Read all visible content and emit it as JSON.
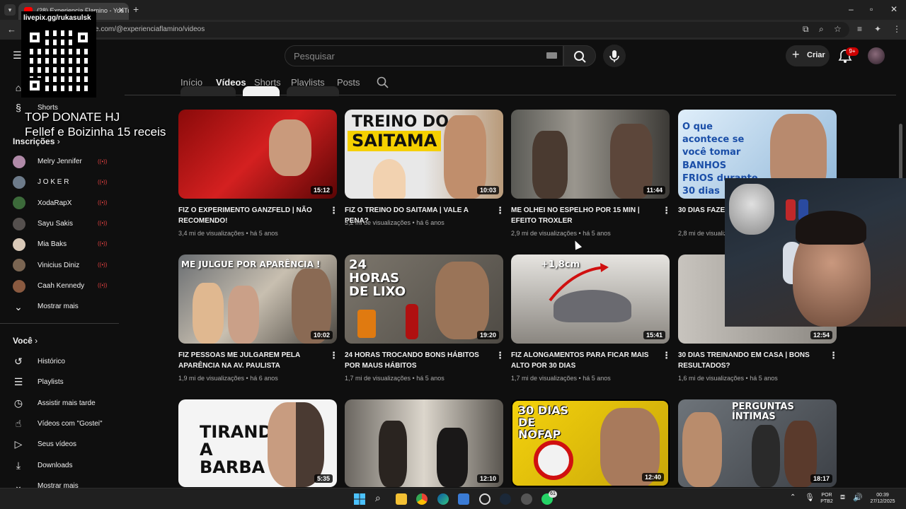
{
  "browser": {
    "tab_title": "(28) Experiencia Flamino - YouTube",
    "url_visible": "e.com/@experienciaflamino/videos"
  },
  "header": {
    "search_placeholder": "Pesquisar",
    "create_label": "Criar",
    "notif_count": "9+"
  },
  "channel_tabs": [
    "Início",
    "Vídeos",
    "Shorts",
    "Playlists",
    "Posts"
  ],
  "active_tab": "Vídeos",
  "sidebar": {
    "shorts_label": "Shorts",
    "subs_heading": "Inscrições",
    "subscriptions": [
      "Melry Jennifer",
      "J O K E R",
      "XodaRapX",
      "Sayu Sakis",
      "Mia Baks",
      "Vinicius Diniz",
      "Caah Kennedy"
    ],
    "show_more": "Mostrar mais",
    "you_heading": "Você",
    "you_items": [
      "Histórico",
      "Playlists",
      "Assistir mais tarde",
      "Vídeos com \"Gostei\"",
      "Seus vídeos",
      "Downloads",
      "Mostrar mais"
    ]
  },
  "overlays": {
    "qr_title": "livepix.gg/rukasulsk",
    "donate_line1": "TOP DONATE HJ",
    "donate_line2": "Fellef e Boizinha 15 receis"
  },
  "videos": [
    {
      "title": "FIZ O EXPERIMENTO GANZFELD | NÃO RECOMENDO!",
      "views": "3,4 mi de visualizações",
      "age": "há 5 anos",
      "duration": "15:12",
      "thumb_text": ""
    },
    {
      "title": "FIZ O TREINO DO SAITAMA | VALE A PENA?",
      "views": "3,2 mi de visualizações",
      "age": "há 6 anos",
      "duration": "10:03",
      "thumb_text": "TREINO DO SAITAMA"
    },
    {
      "title": "ME OLHEI NO ESPELHO POR 15 MIN | EFEITO TROXLER",
      "views": "2,9 mi de visualizações",
      "age": "há 5 anos",
      "duration": "11:44",
      "thumb_text": ""
    },
    {
      "title": "30 DIAS FAZEN... DOENÇA DE P...",
      "views": "2,8 mi de visualiz...",
      "age": "",
      "duration": "",
      "thumb_text": "O que acontece se você tomar BANHOS FRIOS durante 30 dias"
    },
    {
      "title": "FIZ PESSOAS ME JULGAREM PELA APARÊNCIA NA AV. PAULISTA",
      "views": "1,9 mi de visualizações",
      "age": "há 6 anos",
      "duration": "10:02",
      "thumb_text": "ME JULGUE POR APARÊNCIA !"
    },
    {
      "title": "24 HORAS TROCANDO BONS HÁBITOS POR MAUS HÁBITOS",
      "views": "1,7 mi de visualizações",
      "age": "há 5 anos",
      "duration": "19:20",
      "thumb_text": "24 HORAS DE LIXO"
    },
    {
      "title": "FIZ ALONGAMENTOS PARA FICAR MAIS ALTO POR 30 DIAS",
      "views": "1,7 mi de visualizações",
      "age": "há 5 anos",
      "duration": "15:41",
      "thumb_text": "+1,8cm"
    },
    {
      "title": "30 DIAS TREINANDO EM CASA | BONS RESULTADOS?",
      "views": "1,6 mi de visualizações",
      "age": "há 5 anos",
      "duration": "12:54",
      "thumb_text": ""
    },
    {
      "title": "",
      "views": "",
      "age": "",
      "duration": "5:35",
      "thumb_text": "TIRANDO A BARBA"
    },
    {
      "title": "",
      "views": "",
      "age": "",
      "duration": "12:10",
      "thumb_text": ""
    },
    {
      "title": "",
      "views": "",
      "age": "",
      "duration": "12:40",
      "thumb_text": "30 DIAS DE NOFAP"
    },
    {
      "title": "",
      "views": "",
      "age": "",
      "duration": "18:17",
      "thumb_text": "PERGUNTAS ÍNTIMAS"
    }
  ],
  "taskbar": {
    "lang": "POR",
    "layout": "PTB2",
    "time": "00:39",
    "date": "27/12/2025",
    "whatsapp_badge": "61"
  }
}
